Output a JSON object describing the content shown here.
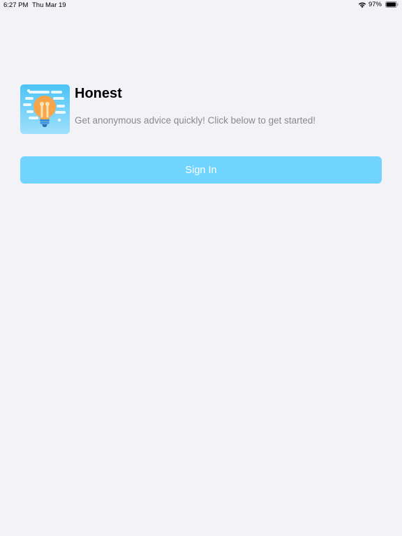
{
  "status_bar": {
    "time": "6:27 PM",
    "date": "Thu Mar 19",
    "battery_percent": "97%",
    "wifi_icon": "wifi-icon",
    "battery_icon": "battery-icon",
    "battery_level": 0.97
  },
  "app": {
    "icon": "lightbulb-icon",
    "title": "Honest",
    "subtitle": "Get anonymous advice quickly! Click below to get started!"
  },
  "actions": {
    "sign_in_label": "Sign In"
  },
  "colors": {
    "background": "#f2f2f7",
    "button": "#71d4fe",
    "button_text": "#ffffff",
    "subtitle_text": "#8a8a8e",
    "icon_gradient_top": "#4cc3f7",
    "icon_gradient_bottom": "#9fe0fb",
    "bulb": "#f7a54b"
  }
}
